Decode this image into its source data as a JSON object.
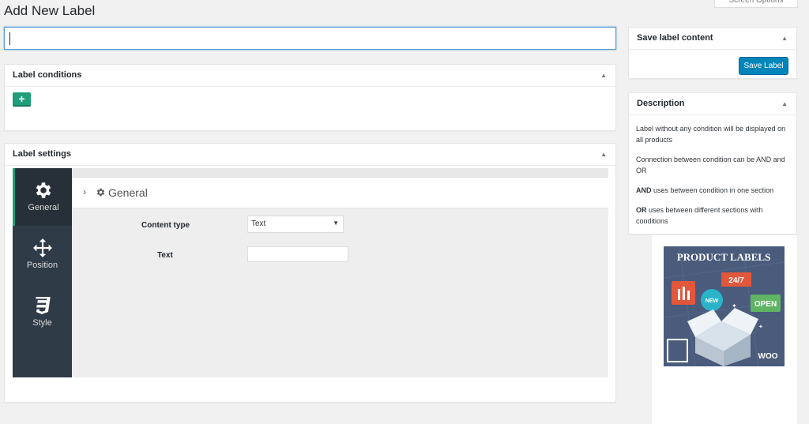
{
  "screen_options": "Screen Options",
  "page_title": "Add New Label",
  "title_input": {
    "value": ""
  },
  "label_conditions": {
    "title": "Label conditions",
    "add_button": "+"
  },
  "label_settings": {
    "title": "Label settings",
    "tabs": [
      {
        "label": "General",
        "icon": "gear-icon",
        "active": true
      },
      {
        "label": "Position",
        "icon": "move-arrows-icon"
      },
      {
        "label": "Style",
        "icon": "css3-icon"
      }
    ],
    "section_title": "General",
    "fields": {
      "content_type_label": "Content type",
      "content_type_value": "Text",
      "text_label": "Text",
      "text_value": ""
    }
  },
  "save_box": {
    "title": "Save label content",
    "button": "Save Label"
  },
  "description": {
    "title": "Description",
    "line1": "Label without any condition will be displayed on all products",
    "line2": "Connection between condition can be AND and OR",
    "and_keyword": "AND",
    "line3_rest": " uses between condition in one section",
    "or_keyword": "OR",
    "line4_rest": " uses between different sections with conditions"
  },
  "banner": {
    "heading": "PRODUCT LABELS",
    "tag_247": "24/7",
    "tag_new": "NEW",
    "tag_open": "OPEN",
    "tag_woo": "WOO"
  },
  "colors": {
    "accent_green": "#1f9e79",
    "primary_blue": "#0085ba",
    "dark_sidebar": "#2f3b46",
    "banner_bg": "#4a5b7c"
  }
}
